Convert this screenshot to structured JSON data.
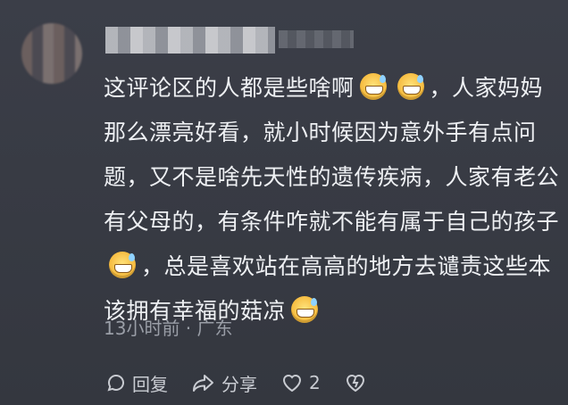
{
  "comment": {
    "segments": [
      {
        "type": "text",
        "value": "这评论区的人都是些啥啊"
      },
      {
        "type": "emoji",
        "name": "grinning-sweat-emoji"
      },
      {
        "type": "emoji",
        "name": "grinning-sweat-emoji"
      },
      {
        "type": "text",
        "value": "，人家妈妈那么漂亮好看，就小时候因为意外手有点问题，又不是啥先天性的遗传疾病，人家有老公有父母的，有条件咋就不能有属于自己的孩子"
      },
      {
        "type": "emoji",
        "name": "grinning-sweat-emoji"
      },
      {
        "type": "text",
        "value": "，总是喜欢站在高高的地方去谴责这些本该拥有幸福的菇凉"
      },
      {
        "type": "emoji",
        "name": "grinning-sweat-emoji"
      }
    ],
    "meta": "13小时前 · 广东"
  },
  "actions": {
    "reply_label": "回复",
    "share_label": "分享",
    "like_count": "2"
  },
  "colors": {
    "background": "#383b45",
    "text": "#eef0f3",
    "meta": "#9a9ea7"
  }
}
